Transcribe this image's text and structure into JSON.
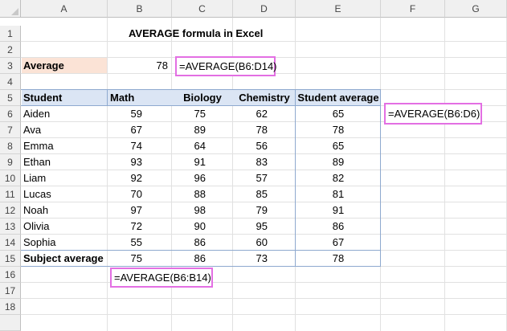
{
  "columns": [
    "A",
    "B",
    "C",
    "D",
    "E",
    "F",
    "G"
  ],
  "rows": [
    "1",
    "2",
    "3",
    "4",
    "5",
    "6",
    "7",
    "8",
    "9",
    "10",
    "11",
    "12",
    "13",
    "14",
    "15",
    "16",
    "17",
    "18"
  ],
  "title": "AVERAGE formula in Excel",
  "average_row": {
    "label": "Average",
    "value": "78",
    "formula": "=AVERAGE(B6:D14)"
  },
  "table": {
    "headers": [
      "Student",
      "Math",
      "Biology",
      "Chemistry",
      "Student average"
    ],
    "rows": [
      [
        "Aiden",
        "59",
        "75",
        "62",
        "65"
      ],
      [
        "Ava",
        "67",
        "89",
        "78",
        "78"
      ],
      [
        "Emma",
        "74",
        "64",
        "56",
        "65"
      ],
      [
        "Ethan",
        "93",
        "91",
        "83",
        "89"
      ],
      [
        "Liam",
        "92",
        "96",
        "57",
        "82"
      ],
      [
        "Lucas",
        "70",
        "88",
        "85",
        "81"
      ],
      [
        "Noah",
        "97",
        "98",
        "79",
        "91"
      ],
      [
        "Olivia",
        "72",
        "90",
        "95",
        "86"
      ],
      [
        "Sophia",
        "55",
        "86",
        "60",
        "67"
      ]
    ],
    "footer": [
      "Subject average",
      "75",
      "86",
      "73",
      "78"
    ]
  },
  "callouts": {
    "student_avg_formula": "=AVERAGE(B6:D6)",
    "subject_avg_formula": "=AVERAGE(B6:B14)"
  },
  "colors": {
    "average_label_fill": "#fbe3d6",
    "header_fill": "#dbe5f4",
    "callout_border": "#e36fe3",
    "table_border": "#8ea9cf"
  }
}
